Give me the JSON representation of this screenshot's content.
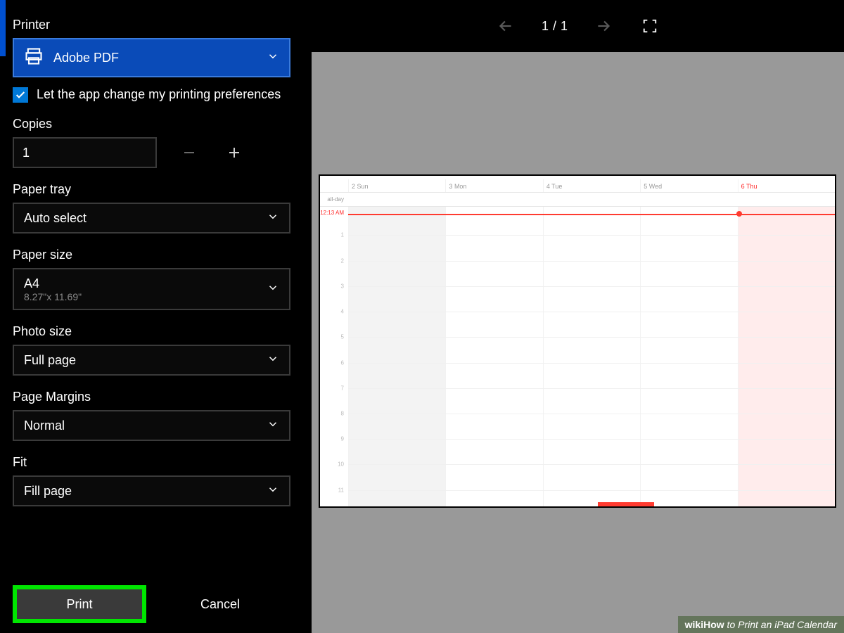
{
  "sidebar": {
    "printer": {
      "label": "Printer",
      "selected": "Adobe PDF"
    },
    "checkbox": {
      "checked": true,
      "text": "Let the app change my printing preferences"
    },
    "copies": {
      "label": "Copies",
      "value": "1"
    },
    "paper_tray": {
      "label": "Paper tray",
      "value": "Auto select"
    },
    "paper_size": {
      "label": "Paper size",
      "value": "A4",
      "sub": "8.27\"x 11.69\""
    },
    "photo_size": {
      "label": "Photo size",
      "value": "Full page"
    },
    "page_margins": {
      "label": "Page Margins",
      "value": "Normal"
    },
    "fit": {
      "label": "Fit",
      "value": "Fill page"
    },
    "buttons": {
      "print": "Print",
      "cancel": "Cancel"
    }
  },
  "preview": {
    "page_current": "1",
    "page_sep": "/",
    "page_total": "1"
  },
  "calendar": {
    "allday_label": "all-day",
    "now_time": "12:13 AM",
    "days": [
      {
        "num": "2",
        "name": "Sun"
      },
      {
        "num": "3",
        "name": "Mon"
      },
      {
        "num": "4",
        "name": "Tue"
      },
      {
        "num": "5",
        "name": "Wed"
      },
      {
        "num": "6",
        "name": "Thu"
      }
    ],
    "hours": [
      "1",
      "2",
      "3",
      "4",
      "5",
      "6",
      "7",
      "8",
      "9",
      "10",
      "11"
    ]
  },
  "watermark": {
    "brand": "wikiHow",
    "text": " to Print an iPad Calendar"
  }
}
